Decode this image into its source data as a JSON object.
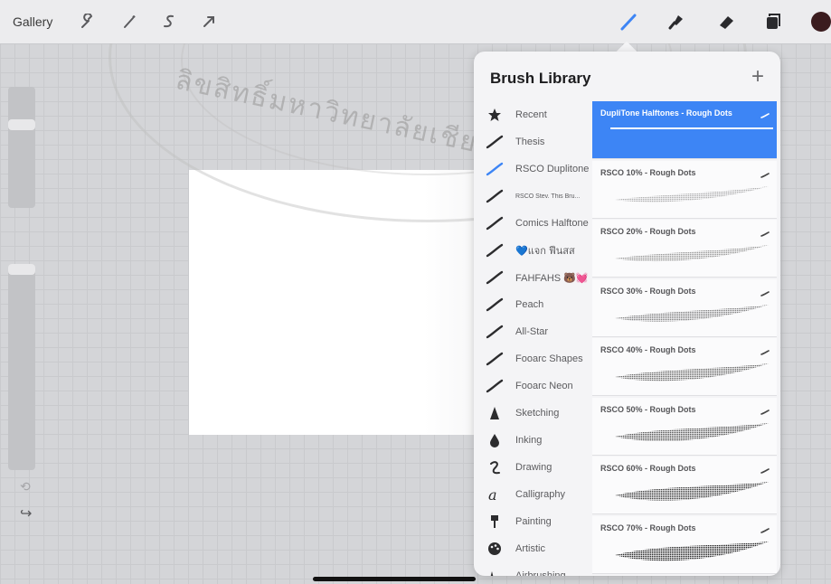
{
  "toolbar": {
    "gallery_label": "Gallery",
    "left_icons": [
      "wrench-icon",
      "magic-wand-icon",
      "selection-icon",
      "transform-arrow-icon"
    ],
    "right_icons": [
      "brush-icon",
      "smudge-icon",
      "eraser-icon",
      "layers-icon",
      "color-swatch-icon"
    ],
    "active_tool": "brush",
    "accent": "#3d85f5",
    "current_color": "#3b1c1f"
  },
  "watermark": {
    "text": "ลิขสิทธิ์มหาวิทยาลัยเชียงใหม่"
  },
  "brush_library": {
    "title": "Brush Library",
    "add_label": "+",
    "sets": [
      {
        "label": "Recent",
        "icon": "star-icon"
      },
      {
        "label": "Thesis",
        "icon": "stroke-icon"
      },
      {
        "label": "RSCO Duplitone",
        "icon": "stroke-icon-blue",
        "selected": true
      },
      {
        "label": "RSCO Stev. This Bru...",
        "icon": "stroke-icon",
        "small": true
      },
      {
        "label": "Comics Halftone",
        "icon": "stroke-icon"
      },
      {
        "label": "💙แจก ฟีนสส",
        "icon": "stroke-icon"
      },
      {
        "label": "FAHFAHS 🐻💓",
        "icon": "stroke-icon"
      },
      {
        "label": "Peach",
        "icon": "stroke-icon"
      },
      {
        "label": "All-Star",
        "icon": "stroke-icon"
      },
      {
        "label": "Fooarc Shapes",
        "icon": "stroke-icon"
      },
      {
        "label": "Fooarc Neon",
        "icon": "stroke-icon"
      },
      {
        "label": "Sketching",
        "icon": "pencil-icon"
      },
      {
        "label": "Inking",
        "icon": "ink-drop-icon"
      },
      {
        "label": "Drawing",
        "icon": "drawing-swirl-icon"
      },
      {
        "label": "Calligraphy",
        "icon": "calligraphy-a-icon"
      },
      {
        "label": "Painting",
        "icon": "paintbrush-icon"
      },
      {
        "label": "Artistic",
        "icon": "palette-icon"
      },
      {
        "label": "Airbrushing",
        "icon": "airbrush-icon"
      }
    ],
    "brushes": [
      {
        "name": "DupliTone Halftones - Rough Dots",
        "selected": true,
        "density": 0
      },
      {
        "name": "RSCO 10% - Rough Dots",
        "density": 0.1
      },
      {
        "name": "RSCO 20% - Rough Dots",
        "density": 0.2
      },
      {
        "name": "RSCO 30% - Rough Dots",
        "density": 0.3
      },
      {
        "name": "RSCO 40% - Rough Dots",
        "density": 0.4
      },
      {
        "name": "RSCO 50% - Rough Dots",
        "density": 0.5
      },
      {
        "name": "RSCO 60% - Rough Dots",
        "density": 0.6
      },
      {
        "name": "RSCO 70% - Rough Dots",
        "density": 0.7
      }
    ]
  }
}
